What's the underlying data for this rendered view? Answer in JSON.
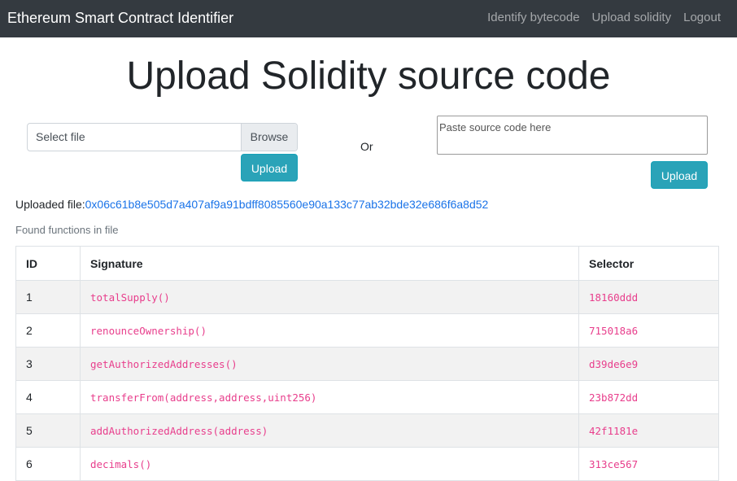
{
  "navbar": {
    "brand": "Ethereum Smart Contract Identifier",
    "links": [
      "Identify bytecode",
      "Upload solidity",
      "Logout"
    ]
  },
  "page": {
    "title": "Upload Solidity source code"
  },
  "file_input": {
    "placeholder": "Select file",
    "browse_label": "Browse",
    "upload_label": "Upload"
  },
  "or_label": "Or",
  "source_input": {
    "placeholder": "Paste source code here",
    "upload_label": "Upload"
  },
  "uploaded": {
    "label": "Uploaded file:",
    "hash": "0x06c61b8e505d7a407af9a91bdff8085560e90a133c77ab32bde32e686f6a8d52"
  },
  "found_label": "Found functions in file",
  "table": {
    "headers": [
      "ID",
      "Signature",
      "Selector"
    ],
    "rows": [
      {
        "id": "1",
        "signature": "totalSupply()",
        "selector": "18160ddd"
      },
      {
        "id": "2",
        "signature": "renounceOwnership()",
        "selector": "715018a6"
      },
      {
        "id": "3",
        "signature": "getAuthorizedAddresses()",
        "selector": "d39de6e9"
      },
      {
        "id": "4",
        "signature": "transferFrom(address,address,uint256)",
        "selector": "23b872dd"
      },
      {
        "id": "5",
        "signature": "addAuthorizedAddress(address)",
        "selector": "42f1181e"
      },
      {
        "id": "6",
        "signature": "decimals()",
        "selector": "313ce567"
      }
    ]
  },
  "colors": {
    "navbar_bg": "#343a40",
    "accent_button": "#2aa3b8",
    "link": "#1a73e8",
    "code_text": "#e83e8c",
    "striped_row": "#f2f2f2"
  }
}
